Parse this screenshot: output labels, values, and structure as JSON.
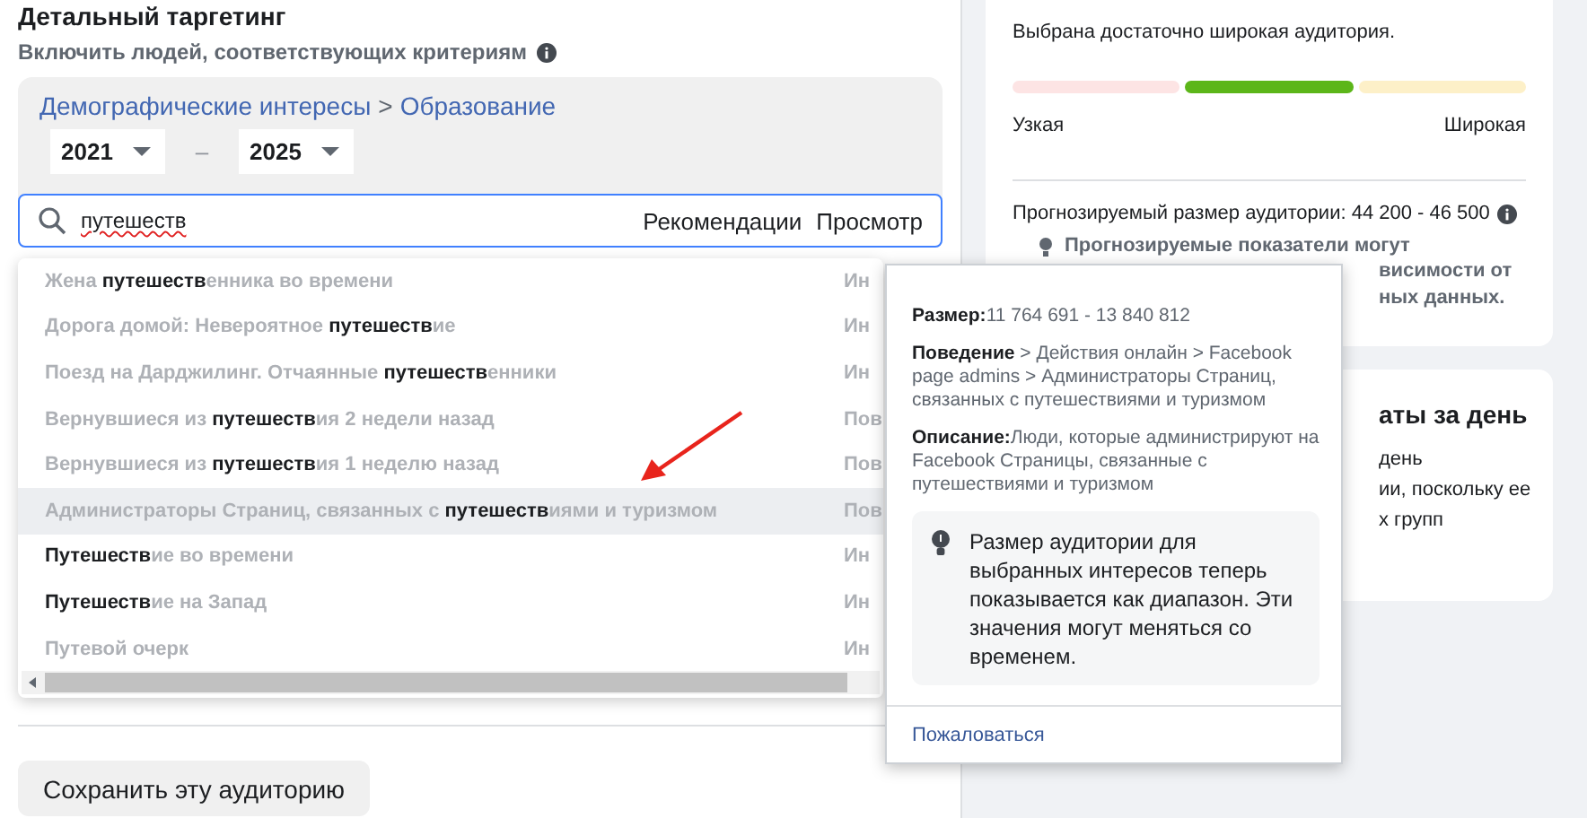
{
  "targeting": {
    "title": "Детальный таргетинг",
    "subtitle": "Включить людей, соответствующих критериям"
  },
  "filter": {
    "breadcrumb": [
      "Демографические интересы",
      "Образование"
    ],
    "breadcrumb_separator": ">",
    "year_from": "2021",
    "range_dash": "–",
    "year_to": "2025"
  },
  "search": {
    "value": "путешеств",
    "links": [
      "Рекомендации",
      "Просмотр"
    ]
  },
  "suggestions": [
    {
      "label": "Жена **путешеств**енника во времени",
      "column_2": "Ин",
      "highlighted": false
    },
    {
      "label": "Дорога домой: Невероятное **путешеств**ие",
      "column_2": "Ин",
      "highlighted": false
    },
    {
      "label": "Поезд на Дарджилинг. Отчаянные **путешеств**енники",
      "column_2": "Ин",
      "highlighted": false
    },
    {
      "label": "Вернувшиеся из **путешеств**ия 2 недели назад",
      "column_2": "Пов",
      "highlighted": false
    },
    {
      "label": "Вернувшиеся из **путешеств**ия 1 неделю назад",
      "column_2": "Пов",
      "highlighted": false
    },
    {
      "label": "Администраторы Страниц, связанных с **путешеств**иями и туризмом",
      "column_2": "Пов",
      "highlighted": true
    },
    {
      "label": "**Путешеств**ие во времени",
      "column_2": "Ин",
      "highlighted": false
    },
    {
      "label": "**Путешеств**ие на Запад",
      "column_2": "Ин",
      "highlighted": false
    },
    {
      "label": "Путевой очерк",
      "column_2": "Ин",
      "highlighted": false
    }
  ],
  "save_button": "Сохранить эту аудиторию",
  "tooltip": {
    "size": "**Размер:**11 764 691 - 13 840 812",
    "path": "**Поведение** > Действия онлайн > Facebook page admins > Администраторы Страниц, связанных с путешествиями и туризмом",
    "description": "**Описание:**Люди, которые администрируют на Facebook Страницы, связанные с путешествиями и туризмом",
    "notice": "Размер аудитории для выбранных интересов теперь показывается как диапазон. Эти значения могут меняться со временем.",
    "report_link": "Пожаловаться"
  },
  "audience_card": {
    "summary": "Выбрана достаточно широкая аудитория.",
    "meter": [
      {
        "color": "#fde4e4"
      },
      {
        "color": "#5cb619"
      },
      {
        "color": "#fdf0c8"
      }
    ],
    "min_label": "Узкая",
    "max_label": "Широкая",
    "estimate": "Прогнозируемый размер аудитории: 44 200 - 46 500",
    "notes": [
      "Прогнозируемые показатели могут",
      "висимости от",
      "ных данных."
    ]
  },
  "daily_card": {
    "title": "аты за день",
    "lines": [
      "день",
      "ии, поскольку ее",
      "х групп"
    ]
  }
}
